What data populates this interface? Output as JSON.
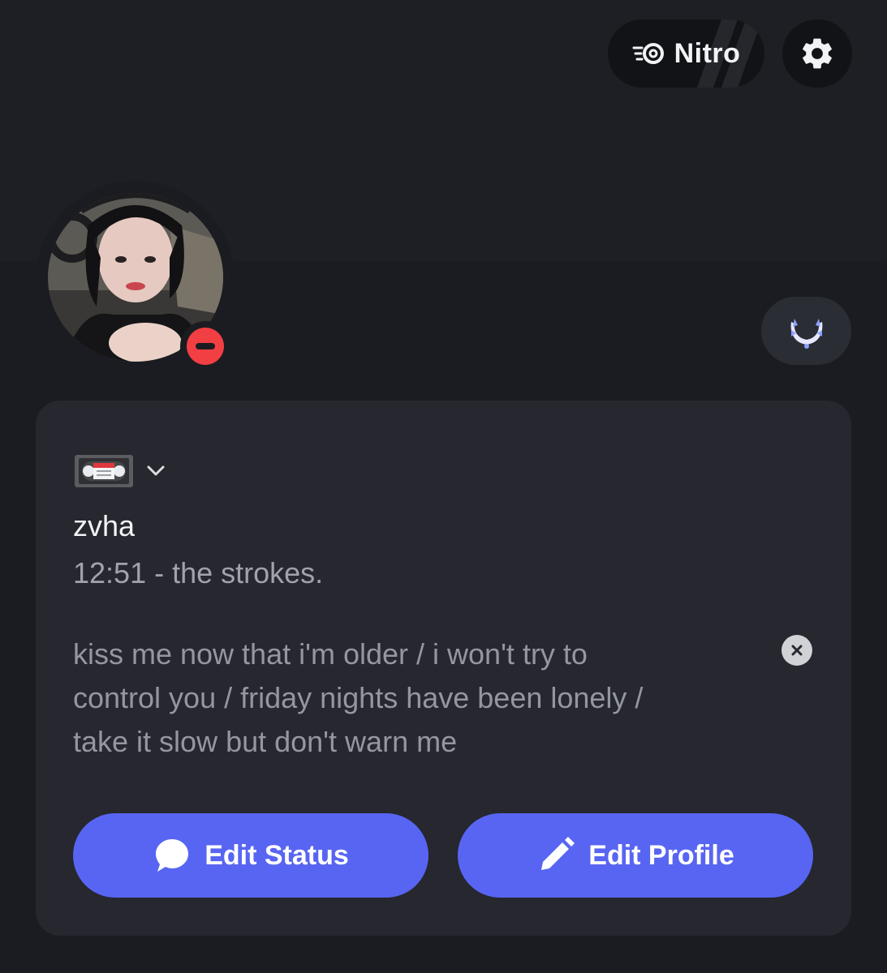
{
  "header": {
    "nitro_label": "Nitro",
    "nitro_icon": "nitro-icon",
    "settings_icon": "gear-icon"
  },
  "profile": {
    "avatar": "avatar",
    "status": "do-not-disturb",
    "status_color": "#f23f43",
    "badge_icon": "laurel-badge-icon"
  },
  "custom_status": {
    "emoji": "videocassette-icon",
    "username": "zvha",
    "song": "12:51 - the strokes.",
    "bio_lines": [
      "kiss me now that i'm older / i won't try to",
      "control you / friday nights have been lonely /",
      "take it slow but don't warn me"
    ]
  },
  "buttons": {
    "edit_status": "Edit Status",
    "edit_profile": "Edit Profile"
  },
  "colors": {
    "accent": "#5865f2",
    "background": "#1b1c21",
    "card": "#26272f"
  }
}
